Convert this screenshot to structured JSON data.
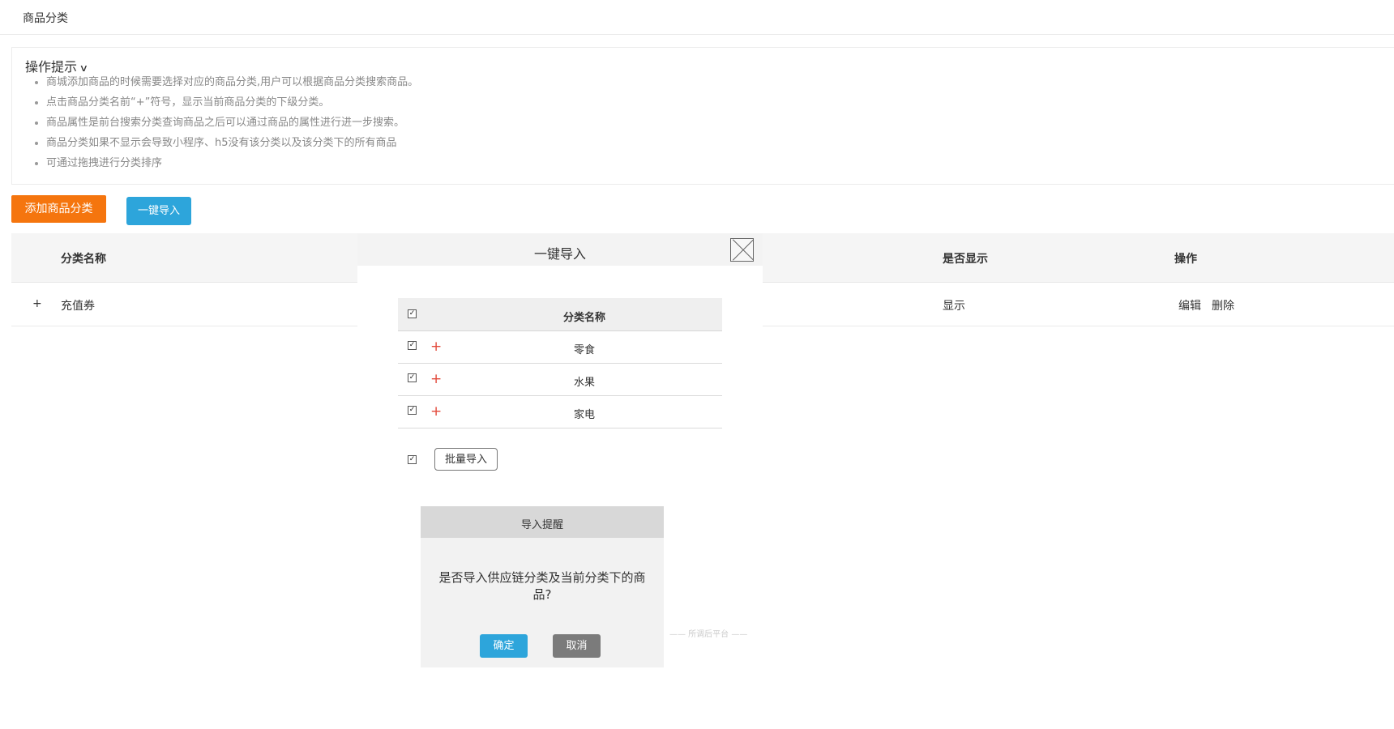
{
  "header": {
    "title": "商品分类"
  },
  "tips": {
    "title": "操作提示",
    "items": [
      "商城添加商品的时候需要选择对应的商品分类,用户可以根据商品分类搜索商品。",
      "点击商品分类名前“+”符号，显示当前商品分类的下级分类。",
      "商品属性是前台搜索分类查询商品之后可以通过商品的属性进行进一步搜索。",
      "商品分类如果不显示会导致小程序、h5没有该分类以及该分类下的所有商品",
      "可通过拖拽进行分类排序"
    ]
  },
  "toolbar": {
    "add_label": "添加商品分类",
    "import_label": "一键导入"
  },
  "table": {
    "columns": [
      "分类名称",
      "是否显示",
      "操作"
    ],
    "rows": [
      {
        "expand": "+",
        "name": "充值券",
        "visible": "显示",
        "edit": "编辑",
        "delete": "删除"
      }
    ]
  },
  "modal": {
    "title": "一键导入",
    "column": "分类名称",
    "rows": [
      {
        "name": "零食",
        "checked": true
      },
      {
        "name": "水果",
        "checked": true
      },
      {
        "name": "家电",
        "checked": true
      }
    ],
    "batch_label": "批量导入"
  },
  "confirm": {
    "title": "导入提醒",
    "message": "是否导入供应链分类及当前分类下的商品?",
    "ok_label": "确定",
    "cancel_label": "取消"
  },
  "watermark": "—— 所调后平台 ——",
  "colors": {
    "orange": "#f5750e",
    "blue": "#2da5db",
    "gray": "#7b7b7b",
    "link": "#e07b2a"
  }
}
